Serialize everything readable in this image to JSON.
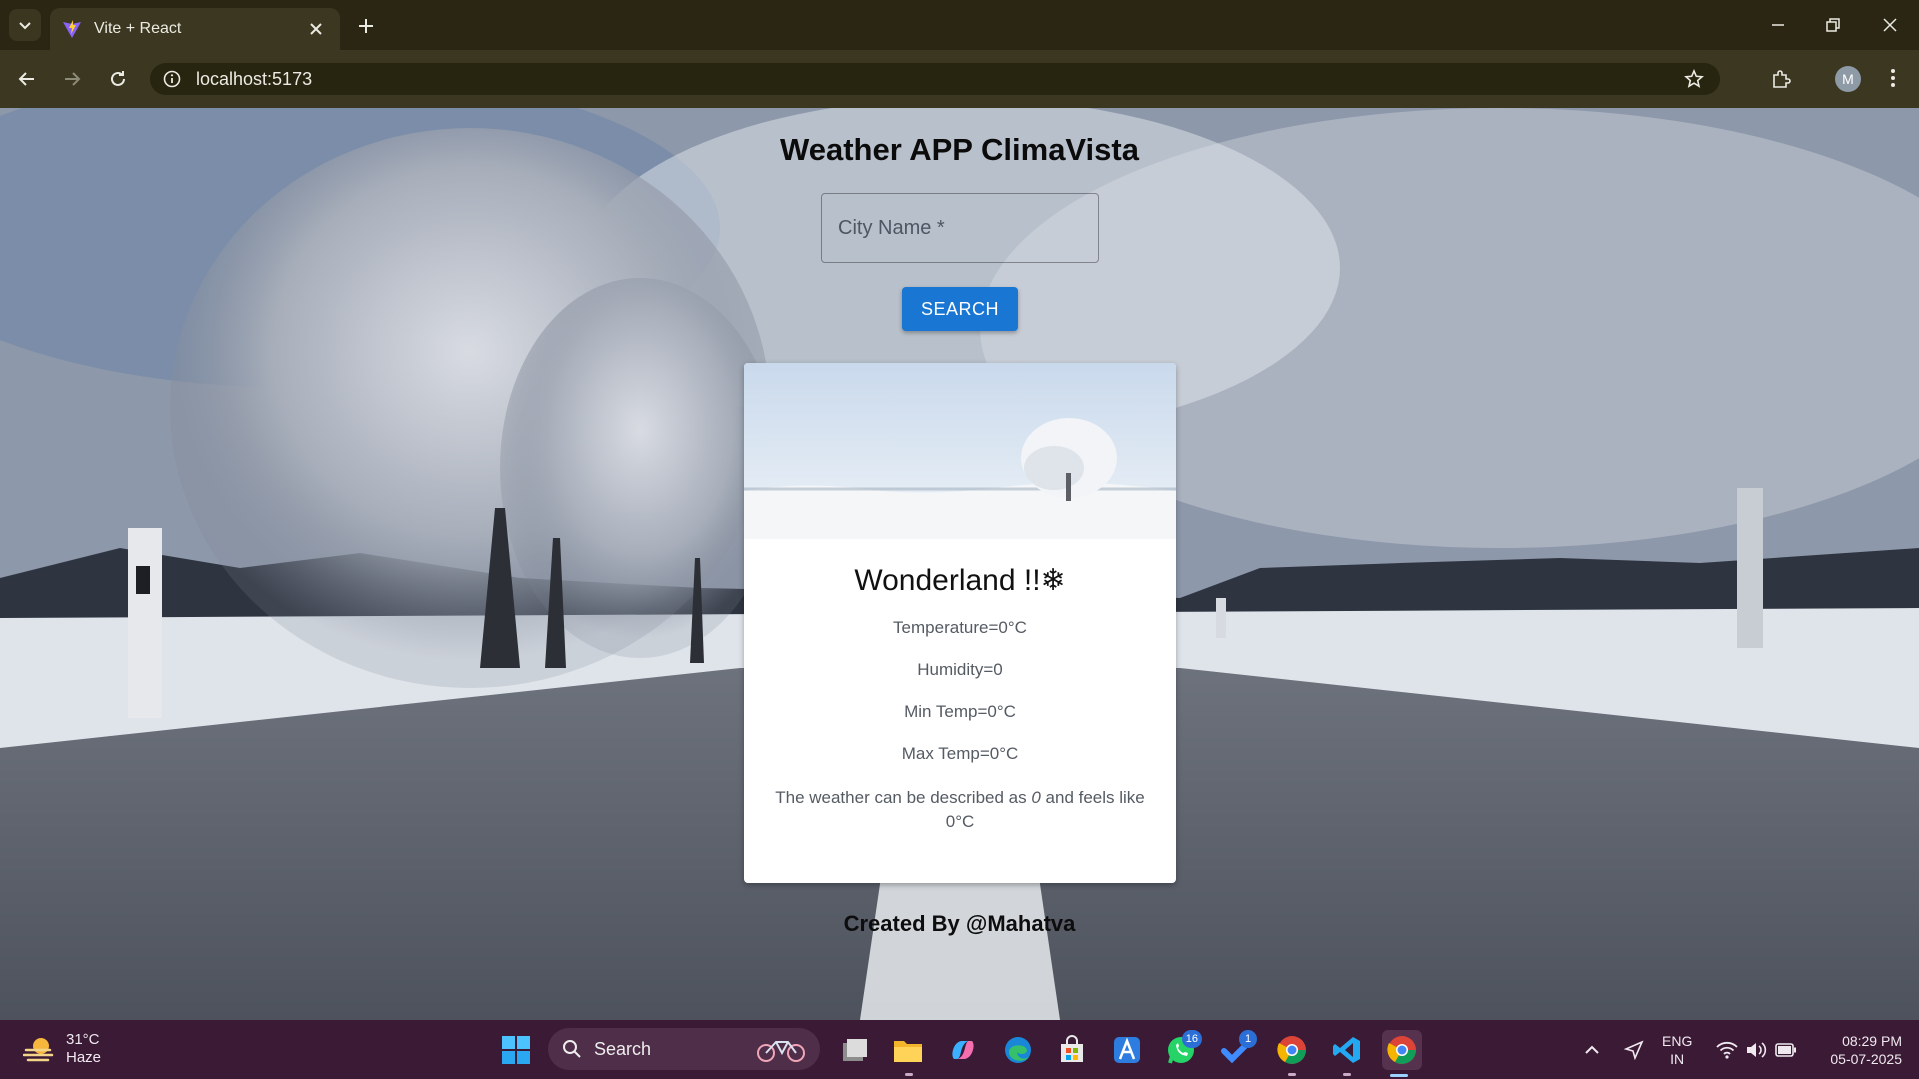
{
  "browser": {
    "tab_title": "Vite + React",
    "url": "localhost:5173",
    "profile_initial": "M"
  },
  "app": {
    "title": "Weather APP ClimaVista",
    "city_placeholder": "City Name *",
    "search_label": "SEARCH",
    "card": {
      "title": "Wonderland !!❄",
      "temperature": "Temperature=0°C",
      "humidity": "Humidity=0",
      "min_temp": "Min Temp=0°C",
      "max_temp": "Max Temp=0°C",
      "desc_prefix": "The weather can be described as ",
      "desc_value": "0",
      "desc_suffix": " and feels like 0°C"
    },
    "footer": "Created By @Mahatva"
  },
  "taskbar": {
    "weather_temp": "31°C",
    "weather_cond": "Haze",
    "search_label": "Search",
    "whatsapp_badge": "16",
    "todo_badge": "1",
    "lang_top": "ENG",
    "lang_bottom": "IN",
    "time": "08:29 PM",
    "date": "05-07-2025"
  },
  "colors": {
    "search_button": "#1976d2",
    "taskbar": "#3b1a35",
    "browser_frame": "#3b3720"
  }
}
